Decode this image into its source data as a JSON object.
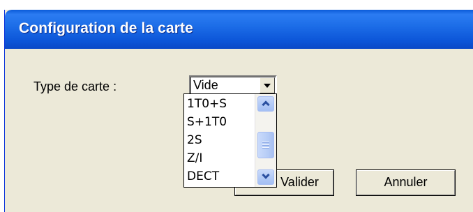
{
  "window": {
    "title": "Configuration de la carte"
  },
  "form": {
    "type_label": "Type de carte :",
    "combo_value": "Vide"
  },
  "dropdown": {
    "items": [
      "1T0+S",
      "S+1T0",
      "2S",
      "Z/I",
      "DECT"
    ]
  },
  "buttons": {
    "valider_label": "Valider",
    "annuler_label": "Annuler"
  },
  "icons": {
    "combo_arrow": "chevron-down-icon",
    "scroll_up": "chevron-up-icon",
    "scroll_down": "chevron-down-icon"
  },
  "colors": {
    "titlebar": "#0c55d8",
    "dialog_bg": "#ece9d8"
  }
}
